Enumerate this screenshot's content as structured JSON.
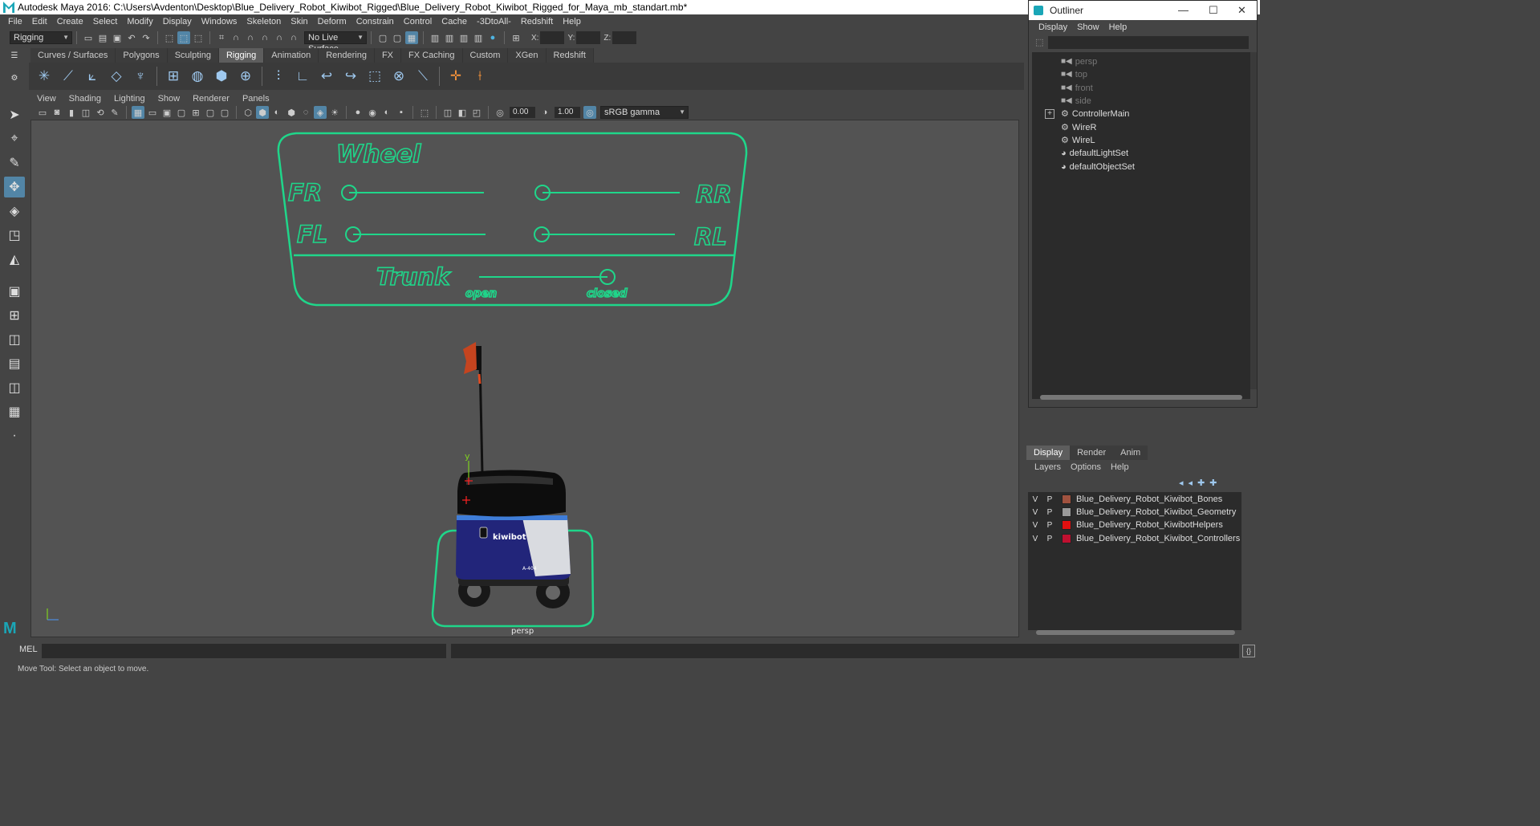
{
  "app": {
    "title": "Autodesk Maya 2016: C:\\Users\\Avdenton\\Desktop\\Blue_Delivery_Robot_Kiwibot_Rigged\\Blue_Delivery_Robot_Kiwibot_Rigged_for_Maya_mb_standart.mb*"
  },
  "menubar": {
    "items": [
      "File",
      "Edit",
      "Create",
      "Select",
      "Modify",
      "Display",
      "Windows",
      "Skeleton",
      "Skin",
      "Deform",
      "Constrain",
      "Control",
      "Cache",
      "-3DtoAll-",
      "Redshift",
      "Help"
    ]
  },
  "statusline": {
    "mode": "Rigging",
    "live_surface": "No Live Surface",
    "x_label": "X:",
    "y_label": "Y:",
    "z_label": "Z:"
  },
  "shelf": {
    "tabs": [
      "Curves / Surfaces",
      "Polygons",
      "Sculpting",
      "Rigging",
      "Animation",
      "Rendering",
      "FX",
      "FX Caching",
      "Custom",
      "XGen",
      "Redshift"
    ],
    "active_tab": "Rigging"
  },
  "viewport": {
    "menus": [
      "View",
      "Shading",
      "Lighting",
      "Show",
      "Renderer",
      "Panels"
    ],
    "exposure": "0.00",
    "gamma": "1.00",
    "color_space": "sRGB gamma",
    "camera_label": "persp",
    "axis_y": "y"
  },
  "controller": {
    "title": "Wheel",
    "fr": "FR",
    "rr": "RR",
    "fl": "FL",
    "rl": "RL",
    "trunk": "Trunk",
    "open": "open",
    "closed": "closed",
    "color": "#1fd68a"
  },
  "robot": {
    "brand": "kiwibot",
    "code": "A-404"
  },
  "cmdline": {
    "label": "MEL"
  },
  "helpline": {
    "text": "Move Tool: Select an object to move."
  },
  "outliner": {
    "title": "Outliner",
    "menus": [
      "Display",
      "Show",
      "Help"
    ],
    "nodes": [
      {
        "label": "persp",
        "dim": true
      },
      {
        "label": "top",
        "dim": true
      },
      {
        "label": "front",
        "dim": true
      },
      {
        "label": "side",
        "dim": true
      },
      {
        "label": "ControllerMain",
        "dim": false
      },
      {
        "label": "WireR",
        "dim": false
      },
      {
        "label": "WireL",
        "dim": false
      },
      {
        "label": "defaultLightSet",
        "dim": false
      },
      {
        "label": "defaultObjectSet",
        "dim": false
      }
    ]
  },
  "layer_editor": {
    "tabs": [
      "Display",
      "Render",
      "Anim"
    ],
    "active_tab": "Display",
    "menus": [
      "Layers",
      "Options",
      "Help"
    ],
    "layers": [
      {
        "v": "V",
        "p": "P",
        "name": "Blue_Delivery_Robot_Kiwibot_Bones",
        "color": "#a0523f"
      },
      {
        "v": "V",
        "p": "P",
        "name": "Blue_Delivery_Robot_Kiwibot_Geometry",
        "color": "#9a9a9a"
      },
      {
        "v": "V",
        "p": "P",
        "name": "Blue_Delivery_Robot_KiwibotHelpers",
        "color": "#e01010"
      },
      {
        "v": "V",
        "p": "P",
        "name": "Blue_Delivery_Robot_Kiwibot_Controllers",
        "color": "#c01030"
      }
    ]
  }
}
